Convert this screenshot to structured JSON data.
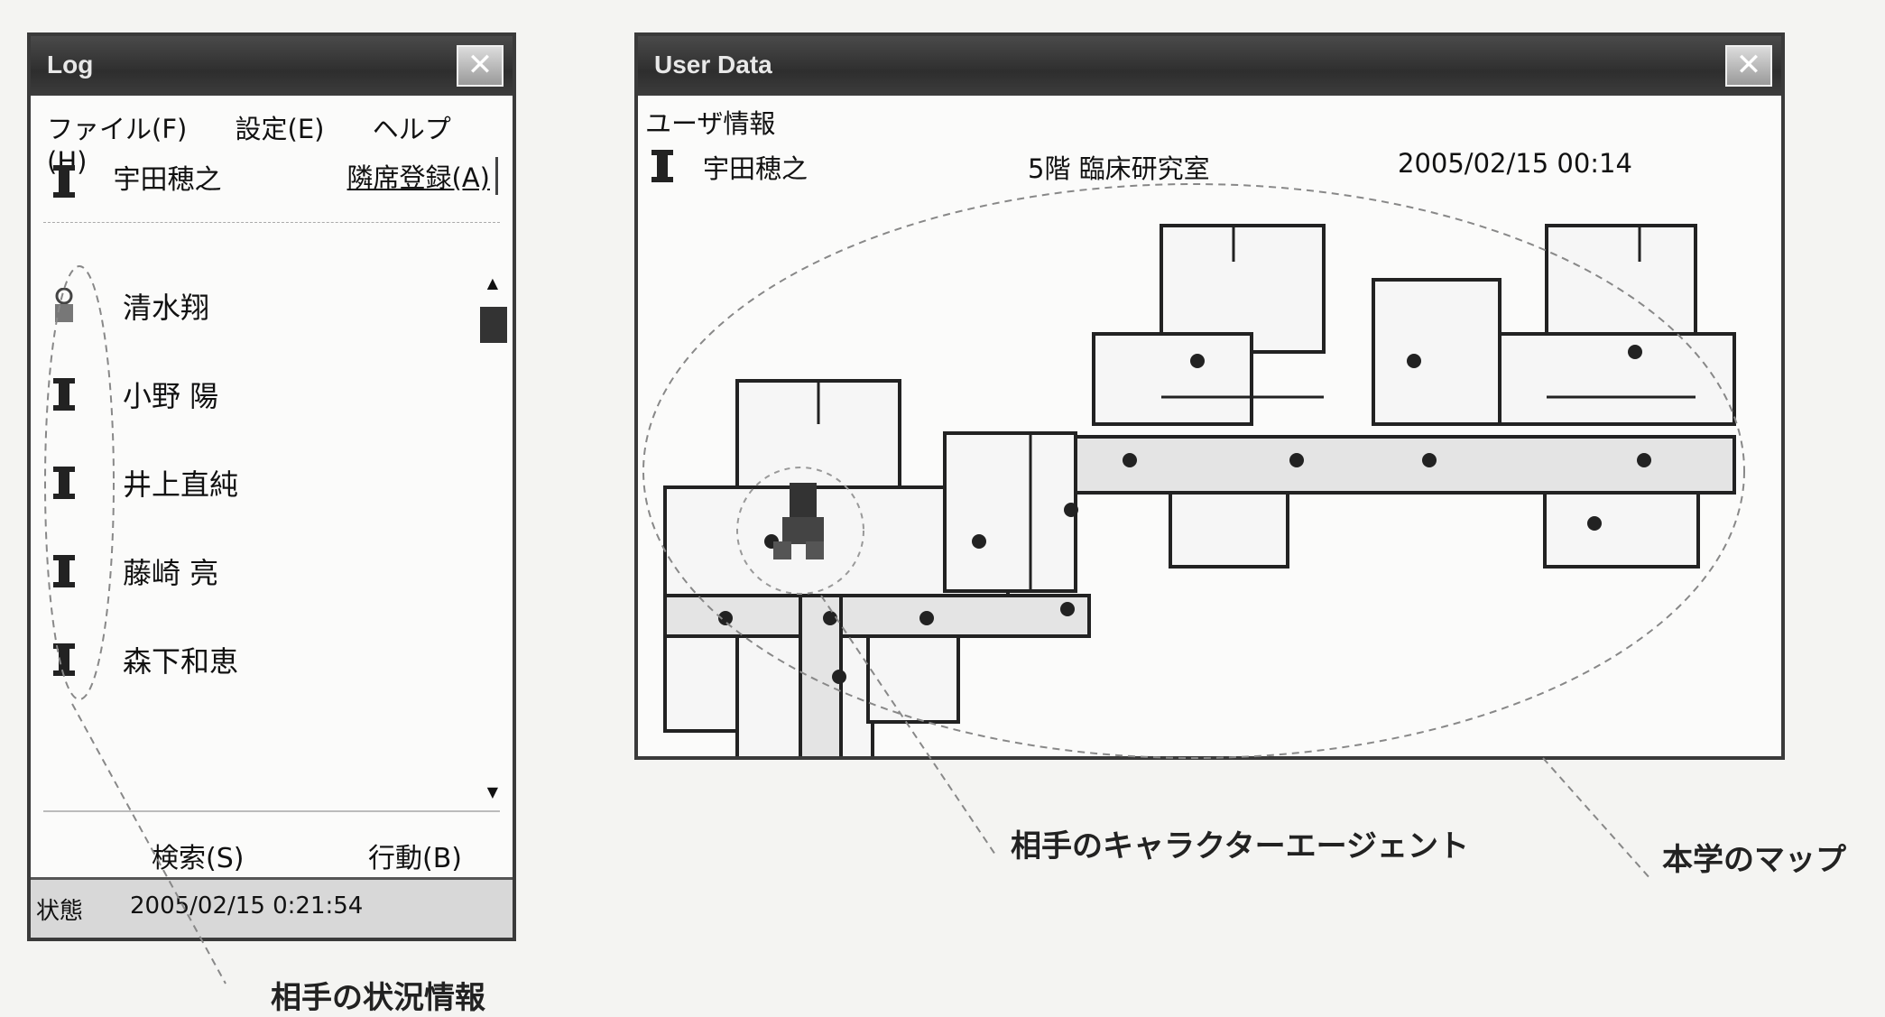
{
  "log_window": {
    "title": "Log",
    "menu": [
      "ファイル(F)",
      "設定(E)",
      "ヘルプ(H)"
    ],
    "current_user": "宇田穂之",
    "register_button": "隣席登録(A)",
    "users": [
      "清水翔",
      "小野 陽",
      "井上直純",
      "藤崎 亮",
      "森下和恵"
    ],
    "buttons": {
      "search": "検索(S)",
      "action": "行動(B)"
    },
    "status": {
      "label": "状態",
      "value": "2005/02/15 0:21:54"
    }
  },
  "user_window": {
    "title": "User Data",
    "header": "ユーザ情報",
    "name": "宇田穂之",
    "location": "5階 臨床研究室",
    "datetime": "2005/02/15 00:14"
  },
  "annotations": {
    "character_agent": "相手のキャラクターエージェント",
    "map": "本学のマップ",
    "status_info": "相手の状況情報"
  },
  "colors": {
    "titlebar": "#3a3a3a",
    "background": "#f4f4f2",
    "floor_wall": "#222222",
    "corridor": "#e4e4e4"
  }
}
